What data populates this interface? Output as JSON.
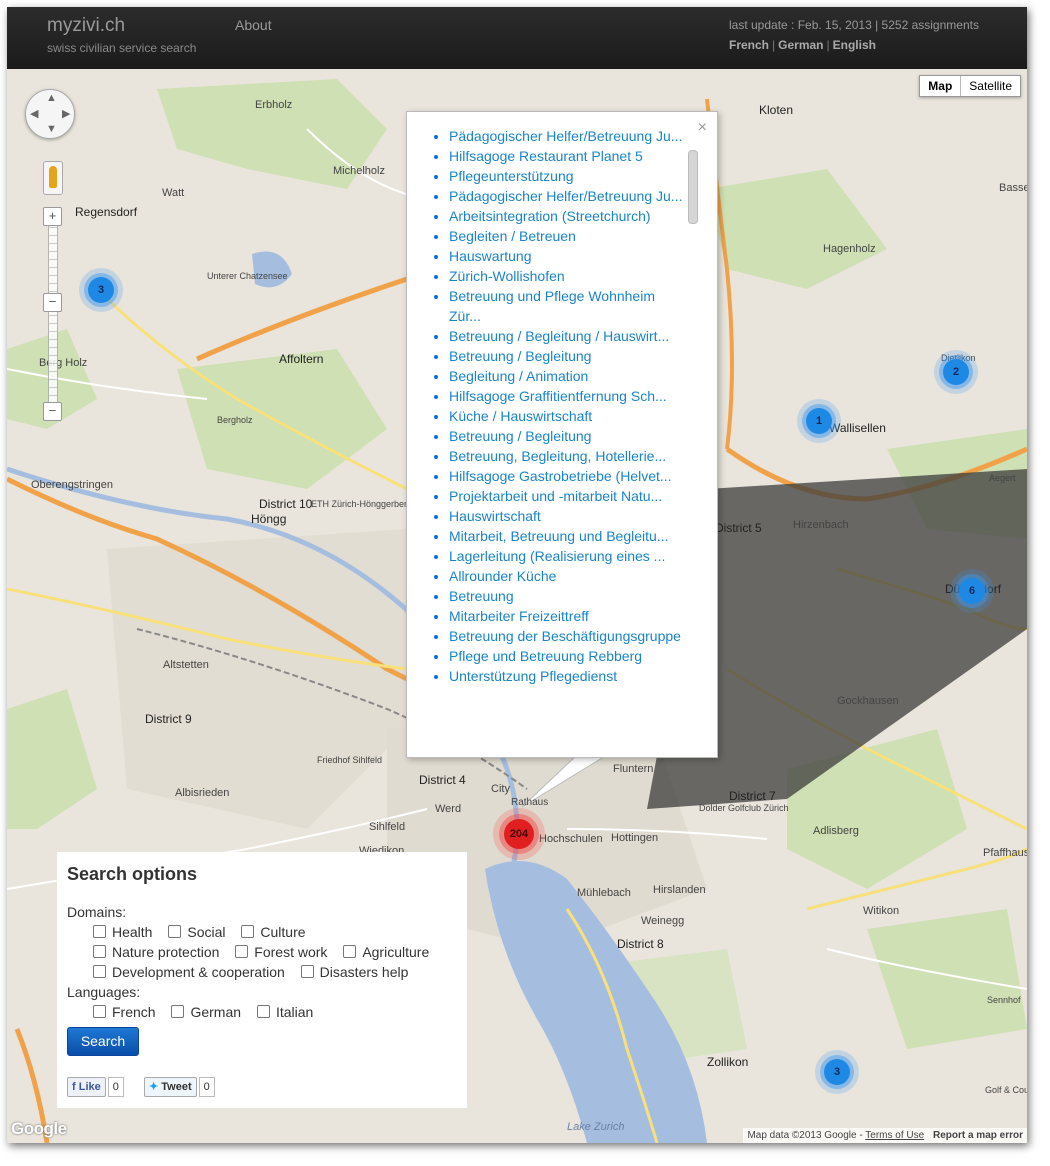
{
  "header": {
    "brand": "myzivi.ch",
    "tagline": "swiss civilian service search",
    "nav_about": "About",
    "last_update": "last update : Feb. 15, 2013 | 5252 assignments",
    "languages": [
      "French",
      "German",
      "English"
    ]
  },
  "map": {
    "type_buttons": [
      "Map",
      "Satellite"
    ],
    "active_type": "Map",
    "labels": [
      "Regensdorf",
      "Watt",
      "Affoltern",
      "Höngg",
      "Altstetten",
      "District 9",
      "District 10",
      "District 4",
      "District 5",
      "City",
      "Werd",
      "Sihlfeld",
      "Albisrieden",
      "Wiedikon",
      "Hochschulen",
      "Hottingen",
      "Hirslanden",
      "Mühlebach",
      "Weinegg",
      "District 8",
      "District 7",
      "Fluntern",
      "Dolder Golfclub Zürich",
      "Adlisberg",
      "Gockhausen",
      "Hirzenbach",
      "Witikon",
      "Zollikon",
      "Pfaffhausen",
      "Kloten",
      "Hagenholz",
      "Dietlikon",
      "Wallisellen",
      "Dübendorf",
      "Bassersdorf",
      "Oberengstringen",
      "Berg Holz",
      "Erbholz",
      "Michelholz",
      "Lake Zurich",
      "Unterer Chatzensee",
      "ETH Zürich-Hönggerberg",
      "Friedhof Sihlfeld",
      "Sennhof",
      "Aegert",
      "Golf & Country Club Zürich",
      "Bergholz",
      "Rathaus"
    ],
    "clusters": [
      {
        "count": "3",
        "color": "blue"
      },
      {
        "count": "2",
        "color": "blue"
      },
      {
        "count": "1",
        "color": "blue"
      },
      {
        "count": "6",
        "color": "blue"
      },
      {
        "count": "204",
        "color": "red"
      },
      {
        "count": "3",
        "color": "blue"
      }
    ],
    "attribution": "Map data ©2013 Google -",
    "terms": "Terms of Use",
    "report": "Report a map error",
    "google_logo": "Google"
  },
  "infowindow": {
    "close": "×",
    "items": [
      "Pädagogischer Helfer/Betreuung Ju...",
      "Hilfsagoge Restaurant Planet 5",
      "Pflegeunterstützung",
      "Pädagogischer Helfer/Betreuung Ju...",
      "Arbeitsintegration (Streetchurch)",
      "Begleiten / Betreuen",
      "Hauswartung",
      "Zürich-Wollishofen",
      "Betreuung und Pflege Wohnheim Zür...",
      "Betreuung / Begleitung / Hauswirt...",
      "Betreuung / Begleitung",
      "Begleitung / Animation",
      "Hilfsagoge Graffitientfernung Sch...",
      "Küche / Hauswirtschaft",
      "Betreuung / Begleitung",
      "Betreuung, Begleitung, Hotellerie...",
      "Hilfsagoge Gastrobetriebe (Helvet...",
      "Projektarbeit und -mitarbeit Natu...",
      "Hauswirtschaft",
      "Mitarbeit, Betreuung und Begleitu...",
      "Lagerleitung (Realisierung eines ...",
      "Allrounder Küche",
      "Betreuung",
      "Mitarbeiter Freizeittreff",
      "Betreuung der Beschäftigungsgruppe",
      "Pflege und Betreuung Rebberg",
      "Unterstützung Pflegedienst"
    ]
  },
  "search": {
    "title": "Search options",
    "domains_label": "Domains:",
    "domains": [
      "Health",
      "Social",
      "Culture",
      "Nature protection",
      "Forest work",
      "Agriculture",
      "Development & cooperation",
      "Disasters help"
    ],
    "languages_label": "Languages:",
    "languages": [
      "French",
      "German",
      "Italian"
    ],
    "button": "Search",
    "like": "Like",
    "like_count": "0",
    "tweet": "Tweet",
    "tweet_count": "0"
  }
}
